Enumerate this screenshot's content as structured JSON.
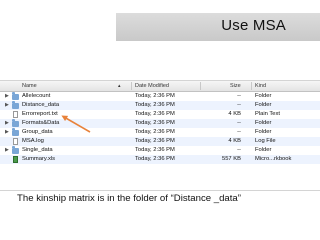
{
  "slide": {
    "title": "Use MSA",
    "caption": "The kinship matrix is in the folder of “Distance _data”"
  },
  "finder": {
    "columns": {
      "name": "Name",
      "date": "Date Modified",
      "size": "Size",
      "kind": "Kind"
    },
    "rows": [
      {
        "name": "Allelecount",
        "date": "Today, 2:36 PM",
        "size": "--",
        "kind": "Folder",
        "icon": "folder-icon",
        "expandable": true
      },
      {
        "name": "Distance_data",
        "date": "Today, 2:36 PM",
        "size": "--",
        "kind": "Folder",
        "icon": "folder-icon",
        "expandable": true
      },
      {
        "name": "Errorreport.txt",
        "date": "Today, 2:36 PM",
        "size": "4 KB",
        "kind": "Plain Text",
        "icon": "text-file-icon",
        "expandable": false
      },
      {
        "name": "Formats&Data",
        "date": "Today, 2:36 PM",
        "size": "--",
        "kind": "Folder",
        "icon": "folder-icon",
        "expandable": true
      },
      {
        "name": "Group_data",
        "date": "Today, 2:36 PM",
        "size": "--",
        "kind": "Folder",
        "icon": "folder-icon",
        "expandable": true
      },
      {
        "name": "MSA.log",
        "date": "Today, 2:36 PM",
        "size": "4 KB",
        "kind": "Log File",
        "icon": "log-file-icon",
        "expandable": false
      },
      {
        "name": "Single_data",
        "date": "Today, 2:36 PM",
        "size": "--",
        "kind": "Folder",
        "icon": "folder-icon",
        "expandable": true
      },
      {
        "name": "Summary.xls",
        "date": "Today, 2:36 PM",
        "size": "557 KB",
        "kind": "Micro...rkbook",
        "icon": "spreadsheet-icon",
        "expandable": false
      }
    ]
  },
  "annotation": {
    "icon": "arrow-pointer-icon",
    "color": "#e8823a",
    "target": "Distance_data"
  }
}
